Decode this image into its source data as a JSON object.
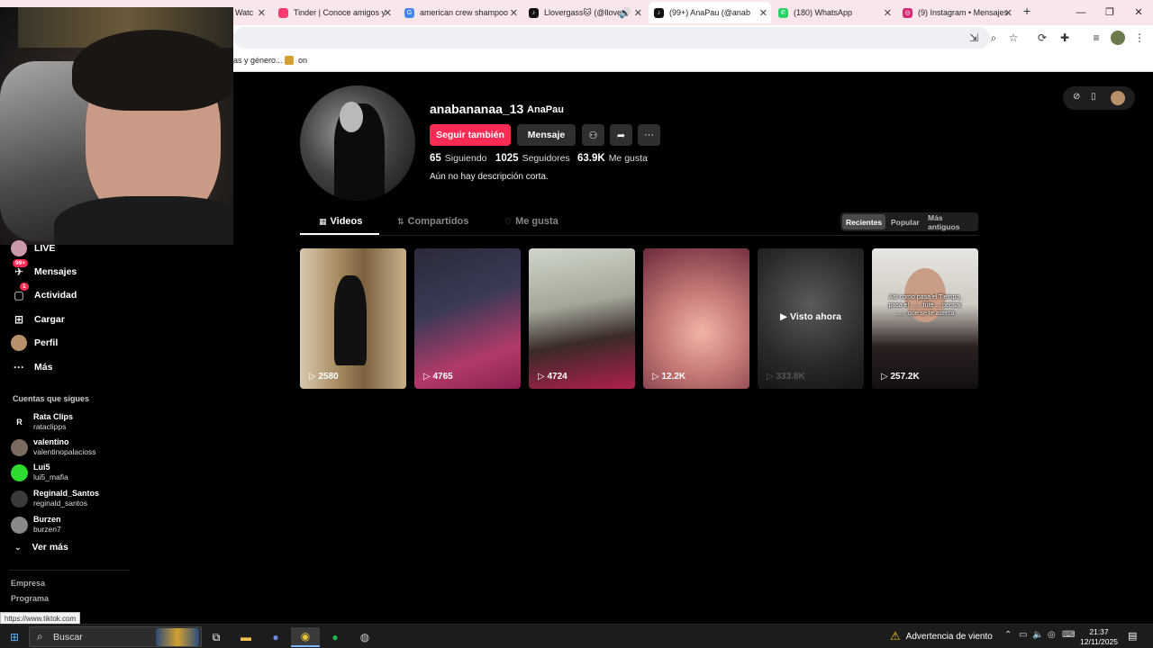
{
  "browser": {
    "tabs": [
      {
        "title": "Watc",
        "favicon_color": "#ff0000",
        "favicon_glyph": ""
      },
      {
        "title": "Tinder | Conoce amigos y",
        "favicon_color": "#fe3c72",
        "favicon_glyph": ""
      },
      {
        "title": "american crew shampoo",
        "favicon_color": "#4285f4",
        "favicon_glyph": "G"
      },
      {
        "title": "Llovergass🐱 (@llove",
        "favicon_color": "#111111",
        "favicon_glyph": "♪"
      },
      {
        "title": "(99+) AnaPau (@anab",
        "favicon_color": "#111111",
        "favicon_glyph": "♪"
      },
      {
        "title": "(180) WhatsApp",
        "favicon_color": "#25d366",
        "favicon_glyph": "✆"
      },
      {
        "title": "(9) Instagram • Mensajes",
        "favicon_color": "#d62976",
        "favicon_glyph": "◎"
      }
    ],
    "new_tab": "+",
    "window_controls": [
      "—",
      "❐",
      "✕"
    ],
    "bookmarks": [
      "as y género...",
      "on"
    ]
  },
  "sidebar": {
    "nav": [
      {
        "label": "LIVE",
        "icon": "live-avatar-icon",
        "glyph": "●",
        "badge": ""
      },
      {
        "label": "Mensajes",
        "icon": "messages-icon",
        "glyph": "✈",
        "badge": "99+"
      },
      {
        "label": "Actividad",
        "icon": "activity-icon",
        "glyph": "▢",
        "badge": "1"
      },
      {
        "label": "Cargar",
        "icon": "upload-icon",
        "glyph": "⊞",
        "badge": ""
      },
      {
        "label": "Perfil",
        "icon": "profile-avatar-icon",
        "glyph": "●",
        "badge": ""
      },
      {
        "label": "Más",
        "icon": "more-dots-icon",
        "glyph": "···",
        "badge": ""
      }
    ],
    "following_title": "Cuentas que sigues",
    "following": [
      {
        "name": "Rata Clips",
        "username": "rataclipps",
        "avatar_color": "#000000",
        "avatar_text": "R"
      },
      {
        "name": "valentino",
        "username": "valentinopalacioss",
        "avatar_color": "#7a6a60",
        "avatar_text": ""
      },
      {
        "name": "Lui5",
        "username": "lui5_mafia",
        "avatar_color": "#2edb2e",
        "avatar_text": ""
      },
      {
        "name": "Reginald_Santos",
        "username": "reginald_santos",
        "avatar_color": "#3a3a3a",
        "avatar_text": ""
      },
      {
        "name": "Burzen",
        "username": "burzen7",
        "avatar_color": "#888888",
        "avatar_text": ""
      }
    ],
    "see_more": "Ver más",
    "footer_links": [
      "Empresa",
      "Programa"
    ],
    "status_url": "https://www.tiktok.com"
  },
  "profile": {
    "username": "anabananaa_13",
    "nickname": "AnaPau",
    "follow_label": "Seguir también",
    "message_label": "Mensaje",
    "stats": [
      {
        "value": "65",
        "label": "Siguiendo"
      },
      {
        "value": "1025",
        "label": "Seguidores"
      },
      {
        "value": "63.9K",
        "label": "Me gusta"
      }
    ],
    "bio": "Aún no hay descripción corta."
  },
  "tabs": [
    {
      "label": "Videos",
      "glyph": "▦"
    },
    {
      "label": "Compartidos",
      "glyph": "⇅"
    },
    {
      "label": "Me gusta",
      "glyph": "♡"
    }
  ],
  "sort": [
    "Recientes",
    "Popular",
    "Más antiguos"
  ],
  "videos": [
    {
      "views": "2580",
      "overlay": "",
      "caption": ""
    },
    {
      "views": "4765",
      "overlay": "",
      "caption": ""
    },
    {
      "views": "4724",
      "overlay": "",
      "caption": ""
    },
    {
      "views": "12.2K",
      "overlay": "",
      "caption": ""
    },
    {
      "views": "333.8K",
      "overlay": "Visto ahora",
      "caption": ""
    },
    {
      "views": "257.2K",
      "overlay": "",
      "caption": "Así como pasa el Tiempo, pasa el ...... fúte ... pensar ...... que se te acerca"
    }
  ],
  "taskbar": {
    "search_label": "Buscar",
    "weather_text": "Advertencia de viento",
    "time": "21:37",
    "date": "12/11/2025"
  }
}
